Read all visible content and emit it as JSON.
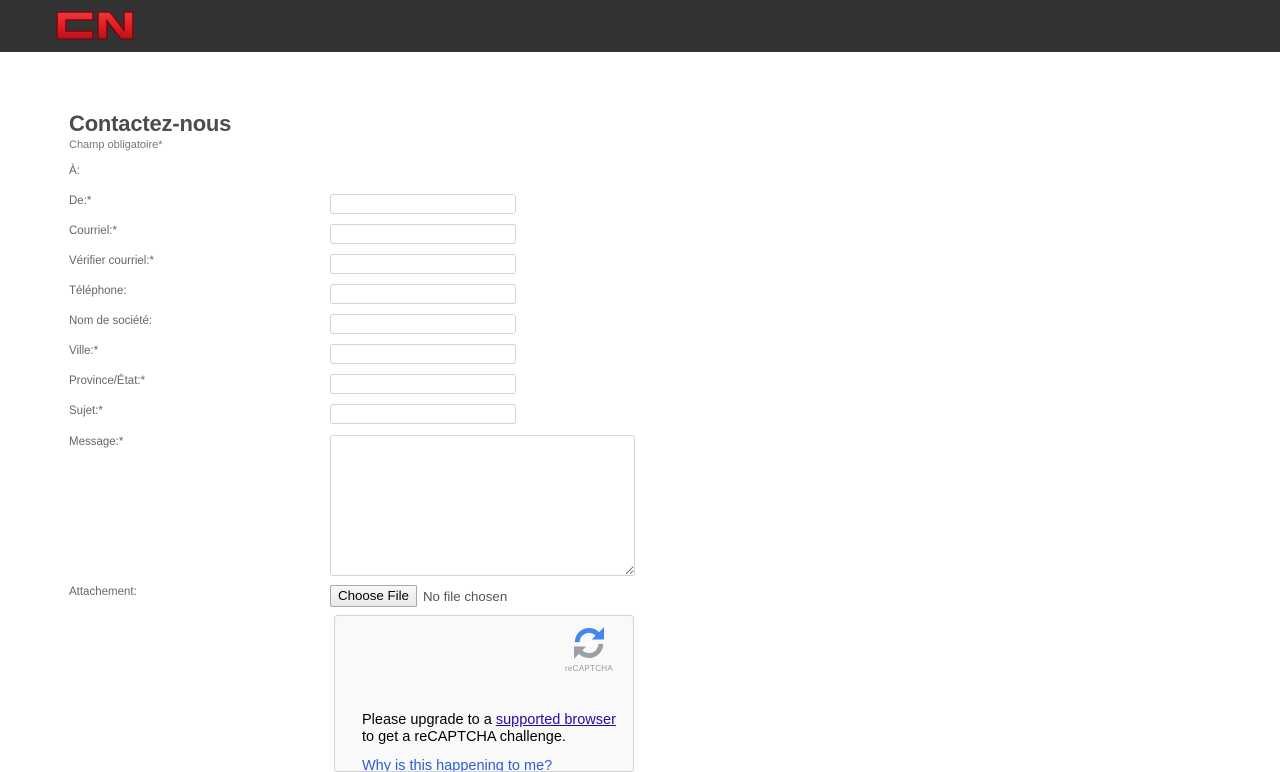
{
  "header": {
    "background_color": "#333333",
    "logo": {
      "name": "cn-logo",
      "alt": "CN",
      "color": "#e31b23",
      "outline_color": "#7a0c10"
    }
  },
  "page": {
    "title": "Contactez-nous",
    "required_note": "Champ obligatoire*",
    "title_color": "#4c4c4c",
    "label_color": "#666666"
  },
  "form": {
    "fields": [
      {
        "key": "to",
        "label": "À:",
        "type": "static",
        "value": ""
      },
      {
        "key": "from",
        "label": "De:*",
        "type": "text",
        "value": "",
        "placeholder": ""
      },
      {
        "key": "email",
        "label": "Courriel:*",
        "type": "text",
        "value": "",
        "placeholder": ""
      },
      {
        "key": "email_verify",
        "label": "Vérifier courriel:*",
        "type": "text",
        "value": "",
        "placeholder": ""
      },
      {
        "key": "phone",
        "label": "Téléphone:",
        "type": "text",
        "value": "",
        "placeholder": ""
      },
      {
        "key": "company",
        "label": "Nom de société:",
        "type": "text",
        "value": "",
        "placeholder": ""
      },
      {
        "key": "city",
        "label": "Ville:*",
        "type": "text",
        "value": "",
        "placeholder": ""
      },
      {
        "key": "province",
        "label": "Province/État:*",
        "type": "text",
        "value": "",
        "placeholder": ""
      },
      {
        "key": "subject",
        "label": "Sujet:*",
        "type": "text",
        "value": "",
        "placeholder": ""
      },
      {
        "key": "message",
        "label": "Message:*",
        "type": "textarea",
        "value": "",
        "placeholder": ""
      },
      {
        "key": "attachment",
        "label": "Attachement:",
        "type": "file",
        "value": ""
      }
    ],
    "file_input": {
      "button_label": "Choose File",
      "status_text": "No file chosen"
    }
  },
  "recaptcha": {
    "brand_name": "reCAPTCHA",
    "message_line1_prefix": "Please upgrade to a ",
    "message_link": "supported browser",
    "message_line2": "to get a reCAPTCHA challenge.",
    "why_link": "Why is this happening to me?",
    "logo_blue": "#4285f4",
    "logo_gray": "#9aa0a6",
    "link_color": "#1a0dab",
    "why_link_color": "#2b5fd9"
  }
}
